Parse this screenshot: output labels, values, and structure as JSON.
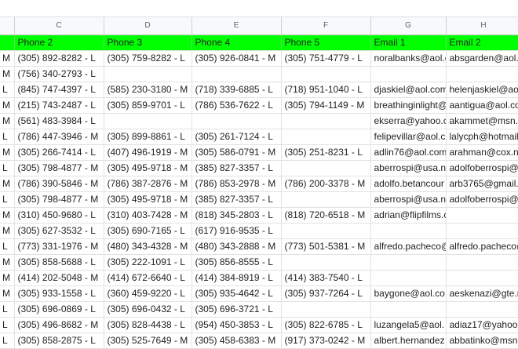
{
  "column_letters": [
    "",
    "C",
    "D",
    "E",
    "F",
    "G",
    "H"
  ],
  "field_headers": [
    "",
    "Phone 2",
    "Phone 3",
    "Phone 4",
    "Phone 5",
    "Email 1",
    "Email 2"
  ],
  "rows": [
    [
      "M",
      "(305) 892-8282 - L",
      "(305) 759-8282 - L",
      "(305) 926-0841 - M",
      "(305) 751-4779 - L",
      "noralbanks@aol.c",
      "absgarden@aol.c"
    ],
    [
      "M",
      "(756) 340-2793 - L",
      "",
      "",
      "",
      "",
      ""
    ],
    [
      "L",
      "(845) 747-4397 - L",
      "(585) 230-3180 - M",
      "(718) 339-6885 - L",
      "(718) 951-1040 - L",
      "djaskiel@aol.com",
      "helenjaskiel@aol"
    ],
    [
      "M",
      "(215) 743-2487 - L",
      "(305) 859-9701 - L",
      "(786) 536-7622 - L",
      "(305) 794-1149 - M",
      "breathinginlight@",
      "aantigua@aol.co"
    ],
    [
      "M",
      "(561) 483-3984 - L",
      "",
      "",
      "",
      "ekserra@yahoo.c",
      "akammet@msn.c"
    ],
    [
      "L",
      "(786) 447-3946 - M",
      "(305) 899-8861 - L",
      "(305) 261-7124 - L",
      "",
      "felipevillar@aol.c",
      "lalycph@hotmail"
    ],
    [
      "M",
      "(305) 266-7414 - L",
      "(407) 496-1919 - M",
      "(305) 586-0791 - M",
      "(305) 251-8231 - L",
      "adlin76@aol.com",
      "arahman@cox.ne"
    ],
    [
      "L",
      "(305) 798-4877 - M",
      "(305) 495-9718 - M",
      "(385) 827-3357 - L",
      "",
      "aberrospi@usa.n",
      "adolfoberrospi@"
    ],
    [
      "M",
      "(786) 390-5846 - M",
      "(786) 387-2876 - M",
      "(786) 853-2978 - M",
      "(786) 200-3378 - M",
      "adolfo.betancour",
      "arb3765@gmail.c"
    ],
    [
      "L",
      "(305) 798-4877 - M",
      "(305) 495-9718 - M",
      "(385) 827-3357 - L",
      "",
      "aberrospi@usa.n",
      "adolfoberrospi@"
    ],
    [
      "M",
      "(310) 450-9680 - L",
      "(310) 403-7428 - M",
      "(818) 345-2803 - L",
      "(818) 720-6518 - M",
      "adrian@flipfilms.com",
      ""
    ],
    [
      "M",
      "(305) 627-3532 - L",
      "(305) 690-7165 - L",
      "(617) 916-9535 - L",
      "",
      "",
      ""
    ],
    [
      "L",
      "(773) 331-1976 - M",
      "(480) 343-4328 - M",
      "(480) 343-2888 - M",
      "(773) 501-5381 - M",
      "alfredo.pacheco@",
      "alfredo.pacheco@"
    ],
    [
      "M",
      "(305) 858-5688 - L",
      "(305) 222-1091 - L",
      "(305) 856-8555 - L",
      "",
      "",
      ""
    ],
    [
      "M",
      "(414) 202-5048 - M",
      "(414) 672-6640 - L",
      "(414) 384-8919 - L",
      "(414) 383-7540 - L",
      "",
      ""
    ],
    [
      "M",
      "(305) 933-1558 - L",
      "(360) 459-9220 - L",
      "(305) 935-4642 - L",
      "(305) 937-7264 - L",
      "baygone@aol.co",
      "aeskenazi@gte.n"
    ],
    [
      "L",
      "(305) 696-0869 - L",
      "(305) 696-0432 - L",
      "(305) 696-3721 - L",
      "",
      "",
      ""
    ],
    [
      "L",
      "(305) 496-8682 - M",
      "(305) 828-4438 - L",
      "(954) 450-3853 - L",
      "(305) 822-6785 - L",
      "luzangela5@aol.",
      "adiaz17@yahoo."
    ],
    [
      "L",
      "(305) 858-2875 - L",
      "(305) 525-7649 - M",
      "(305) 458-6383 - M",
      "(917) 373-0242 - M",
      "albert.hernandez",
      "abbatinko@msn.c"
    ]
  ]
}
